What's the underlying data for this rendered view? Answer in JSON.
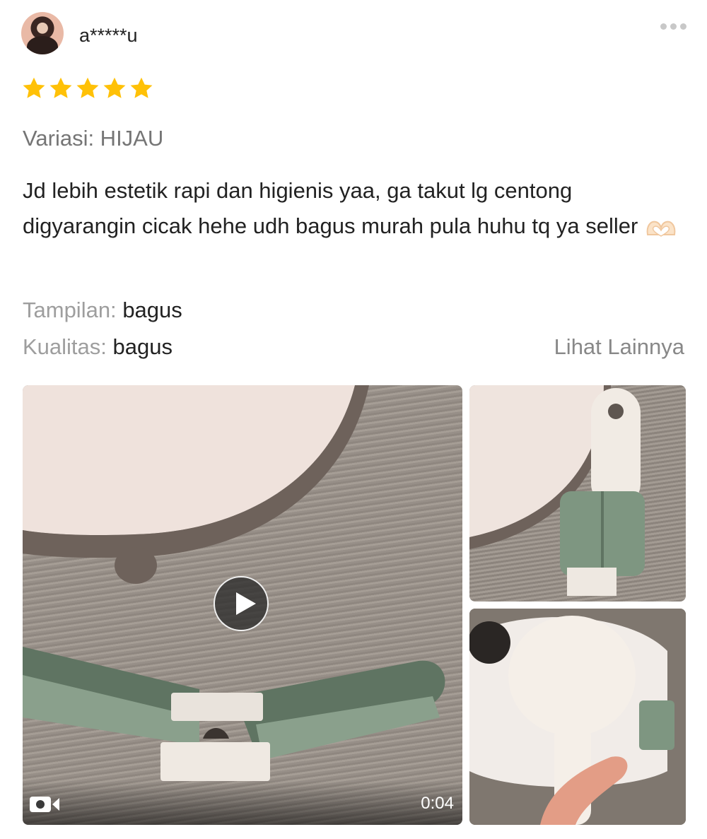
{
  "review": {
    "username": "a*****u",
    "rating": 5,
    "rating_max": 5,
    "variation": "Variasi: HIJAU",
    "text": "Jd lebih estetik rapi dan higienis yaa, ga takut lg centong digyarangin cicak hehe udh bagus murah pula huhu tq ya seller",
    "emoji_icon": "heart-hands-icon",
    "attributes": [
      {
        "label": "Tampilan:",
        "value": "bagus"
      },
      {
        "label": "Kualitas:",
        "value": "bagus"
      }
    ],
    "see_more": "Lihat Lainnya"
  },
  "media": {
    "video": {
      "duration": "0:04",
      "icon": "video-camera-icon",
      "play_icon": "play-icon"
    },
    "photos": [
      "rice-paddle-holder-photo",
      "rice-paddle-photo"
    ]
  },
  "colors": {
    "star": "#FFC107",
    "text": "#222222",
    "muted": "#757575",
    "light_muted": "#9E9E9E",
    "holder_green": "#7E9681"
  }
}
